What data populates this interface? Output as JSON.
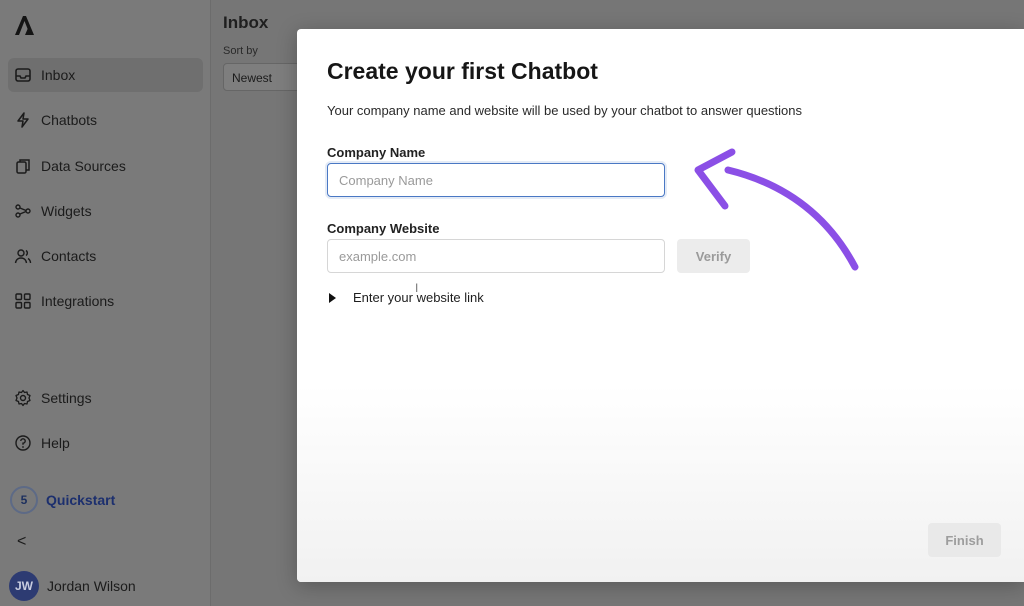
{
  "sidebar": {
    "items": [
      {
        "label": "Inbox",
        "icon": "inbox-icon"
      },
      {
        "label": "Chatbots",
        "icon": "lightning-icon"
      },
      {
        "label": "Data Sources",
        "icon": "documents-icon"
      },
      {
        "label": "Widgets",
        "icon": "widgets-icon"
      },
      {
        "label": "Contacts",
        "icon": "contacts-icon"
      },
      {
        "label": "Integrations",
        "icon": "grid-icon"
      }
    ],
    "bottom_items": [
      {
        "label": "Settings",
        "icon": "gear-icon"
      },
      {
        "label": "Help",
        "icon": "help-icon"
      }
    ],
    "quickstart": {
      "count": "5",
      "label": "Quickstart"
    },
    "collapse": "<",
    "user": {
      "initials": "JW",
      "name": "Jordan Wilson"
    }
  },
  "inbox": {
    "title": "Inbox",
    "sort_label": "Sort by",
    "sort_value": "Newest"
  },
  "modal": {
    "title": "Create your first Chatbot",
    "subtitle": "Your company name and website will be used by your chatbot to answer questions",
    "company_name": {
      "label": "Company Name",
      "placeholder": "Company Name",
      "value": ""
    },
    "company_website": {
      "label": "Company Website",
      "placeholder": "example.com",
      "value": ""
    },
    "verify_label": "Verify",
    "disclosure_label": "Enter your website link",
    "finish_label": "Finish"
  },
  "colors": {
    "accent": "#4a78c4",
    "annotation_arrow": "#8b4fe6",
    "quickstart": "#1c2f6e"
  }
}
